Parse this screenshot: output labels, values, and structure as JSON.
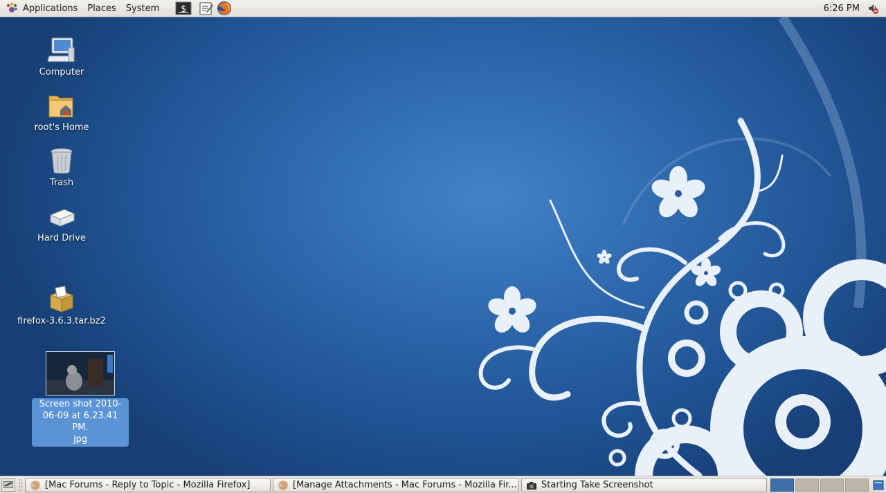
{
  "top_panel": {
    "menus": [
      "Applications",
      "Places",
      "System"
    ],
    "clock": "6:26 PM"
  },
  "desktop_icons": [
    {
      "label": "Computer",
      "icon": "computer-icon"
    },
    {
      "label": "root's Home",
      "icon": "home-folder-icon"
    },
    {
      "label": "Trash",
      "icon": "trash-icon"
    },
    {
      "label": "Hard Drive",
      "icon": "hard-drive-icon"
    },
    {
      "label": "firefox-3.6.3.tar.bz2",
      "icon": "archive-icon"
    }
  ],
  "selected_file": {
    "label_line1": "Screen shot 2010-",
    "label_line2": "06-09 at 6.23.41 PM.",
    "label_line3": "jpg"
  },
  "taskbar": {
    "tasks": [
      {
        "label": "[Mac Forums - Reply to Topic - Mozilla Firefox]",
        "icon": "firefox-icon"
      },
      {
        "label": "[Manage Attachments - Mac Forums - Mozilla Fir...",
        "icon": "firefox-icon"
      },
      {
        "label": "Starting Take Screenshot",
        "icon": "camera-icon"
      }
    ],
    "workspaces": 4
  },
  "colors": {
    "desktop_blue": "#1d4f8e",
    "selection": "#5a93d6",
    "panel": "#e8e5e0"
  }
}
